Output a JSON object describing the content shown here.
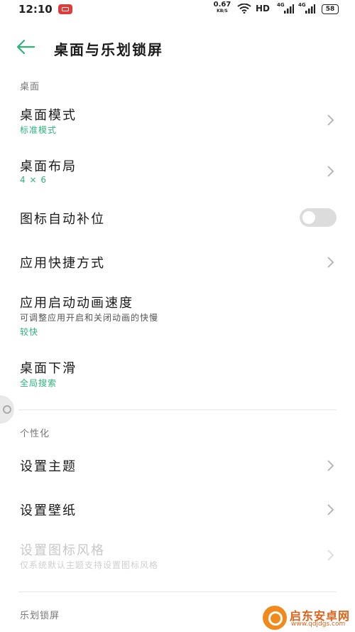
{
  "status_bar": {
    "time": "12:10",
    "net_speed": "0.67",
    "net_speed_unit": "KB/S",
    "hd_label": "HD",
    "sim1_net": "4G",
    "sim2_net": "4G",
    "battery": "58"
  },
  "header": {
    "title": "桌面与乐划锁屏"
  },
  "sections": {
    "desktop": {
      "header": "桌面"
    },
    "personalization": {
      "header": "个性化"
    },
    "lockscreen": {
      "header": "乐划锁屏"
    }
  },
  "items": {
    "desktop_mode": {
      "title": "桌面模式",
      "value": "标准模式"
    },
    "desktop_layout": {
      "title": "桌面布局",
      "value": "4 × 6"
    },
    "auto_fill_icons": {
      "title": "图标自动补位",
      "toggle": false
    },
    "app_shortcuts": {
      "title": "应用快捷方式"
    },
    "app_anim_speed": {
      "title": "应用启动动画速度",
      "subtitle": "可调整应用开启和关闭动画的快慢",
      "value": "较快"
    },
    "swipe_down": {
      "title": "桌面下滑",
      "value": "全局搜索"
    },
    "set_theme": {
      "title": "设置主题"
    },
    "set_wallpaper": {
      "title": "设置壁纸"
    },
    "icon_style": {
      "title": "设置图标风格",
      "subtitle": "仅系统默认主题支持设置图标风格"
    }
  },
  "watermark": {
    "name": "启东安卓网",
    "url": "www.qdjdgs.com"
  },
  "colors": {
    "accent": "#2db37a",
    "background": "#ffffff",
    "status_record": "#e03b3b"
  }
}
